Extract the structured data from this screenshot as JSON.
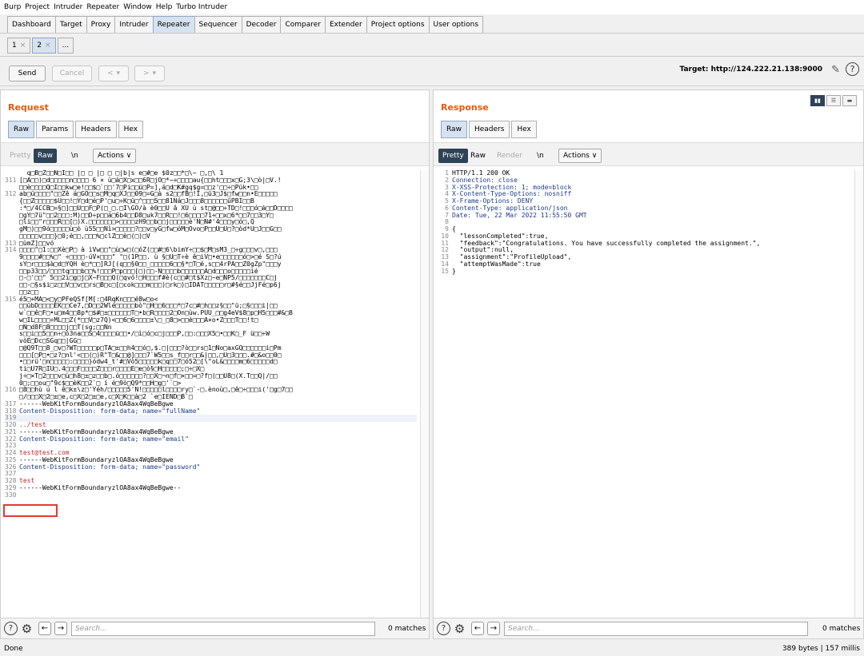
{
  "menu": [
    "Burp",
    "Project",
    "Intruder",
    "Repeater",
    "Window",
    "Help",
    "Turbo Intruder"
  ],
  "main_tabs": [
    "Dashboard",
    "Target",
    "Proxy",
    "Intruder",
    "Repeater",
    "Sequencer",
    "Decoder",
    "Comparer",
    "Extender",
    "Project options",
    "User options"
  ],
  "repeater_tabs": {
    "tab1": "1",
    "tab2": "2",
    "more": "..."
  },
  "toolbar": {
    "send": "Send",
    "cancel": "Cancel",
    "back": "<",
    "back_drop": "▾",
    "fwd": ">",
    "fwd_drop": "▾",
    "target": "Target: http://124.222.21.138:9000"
  },
  "request": {
    "title": "Request",
    "tabs": [
      "Raw",
      "Params",
      "Headers",
      "Hex"
    ],
    "pretty": "Pretty",
    "raw": "Raw",
    "newline": "\\n",
    "actions": "Actions ∨",
    "lines": [
      {
        "n": "",
        "t": "  q□B□Z□□N□I□□ |□ □ |□ □ □|b|s e□#□e $0z□□*□\\~ □,□\\ 1"
      },
      {
        "n": "311",
        "t": "[□A□□)□d□□□□□n□□□□ 6 × ù□á□X□x□□6R□jO□*~÷□□□□au{□□ht□□□x□G;3\\□ò|□V.!"
      },
      {
        "n": "",
        "t": "□□è□□□□Q□I□□kw□e!□□$□`□□'7□Pi□□ü□P=],á□d□K#gq$g=□□z'□□÷□Pük•□□"
      },
      {
        "n": "312",
        "t": "ab□ü□□□□\"□□Zê á□GO□□s□M□q□XJ□□09□=G□à s2□□fB□!I,□ü3□J$□fw□□n•E□□□□□"
      },
      {
        "n": "",
        "t": "{□□Z□□□□□$U□□!□Y□d□é□P'□u□÷K□ü□^□□□5□□81Ná□J□□□8□□□□□□ûPBI□□B"
      },
      {
        "n": "",
        "t": ":*□/4CCB□=§□]□□U□□F□P(□_□.□I\\GO/à è0□□U â XU ù st□@□□÷TD□!□□□ó□à□□D□□□□"
      },
      {
        "n": "",
        "t": "□gY□7ü\"□□2□□□:M)□□D÷p□□á□6b4□□D8□uk7□□R□□!□6□□□□71÷□□x□6*□□7□□3□Y□"
      },
      {
        "n": "",
        "t": "□li□□\"r□□□R□□[□)X.□□□□□□□>□□□□zH9□□b□□j□□□□□è'N□N#'4□□□y□ó□,Q"
      },
      {
        "n": "",
        "t": "gM□)□□9ó□□□□□ù□ò ù55□□Nì>□□□□□?□□v□yG□fw□óM□Ovo□P□□U□U□?□òd*U□J□□G□□"
      },
      {
        "n": "",
        "t": "□□□□□v□□□}□0;é□□,□□□%□clZ□□è□(□)□V"
      },
      {
        "n": "313",
        "t": "□ùmZ]□□vó"
      },
      {
        "n": "314",
        "t": "□□□□\"□1:□□Xè□P□ à ìVw□□\"□ù□w□(□óZ(□□#□6\\bimY÷□□$□M□sM3_□÷g□□□v□,□□□"
      },
      {
        "n": "",
        "t": "9□□□□#□□%□\" ÷□□□□-úV×□□□\" \"□(1P□□. ù §□U□T÷è ê□iV□•e□□□□□□ó□>□é S□?ú"
      },
      {
        "n": "",
        "t": "sY□r□□□$à□d□YQH è□*□□]RJ[(q□□§0□□_□□□□□6□□§*□T□é,s□□4rPA□□Z0gZp\"□□□y"
      },
      {
        "n": "",
        "t": "□□p33□□/□□□tq□□□b□□%!□□□P□p□□□[□)□□-N□□□□b□□□□□□A□d□□□o□□□□□ié"
      },
      {
        "n": "",
        "t": "□-□'□□\" 5□□2ì□g□j□X~F□□□Q(□qvó!□H□□□f#è(c□□#□t$Xz□~e□NP5/□□□□□□□C□j"
      },
      {
        "n": "",
        "t": "□□-□§s$i□z□□V□□v□□rs□B□c□[□cok□□□m□□□)□rk□)□IDAT□□□□□r□#§é□□JjFé□p6j"
      },
      {
        "n": "",
        "t": "□□z□□"
      },
      {
        "n": "315",
        "t": "é5□+MA□<□y□PFeQSf[M[:□4RqKn□□□é8w□o<"
      },
      {
        "n": "",
        "t": "□□übD□□□□EK□□Ce7,□D□□2Wlé□□□□□bò\"□H□□6□□□*□7c□#□h□□z§□□\"ü;□§□□□i|□□"
      },
      {
        "n": "",
        "t": "w`□□ê□F□•u□m4□□8p*□$#□±□□□□□□T□•b□R□□□□2□On□ùw.PUU_□□g4eV$8□p□H5□□□#&□8"
      },
      {
        "n": "",
        "t": "w□IL□□□□÷ML□□Z(*□□V□z7Q)<□□6□6□□□□±\\□_□8□>□□è□□□A×o•Z□□□T□□!t□"
      },
      {
        "n": "",
        "t": "□N□d8F□8□□□□j□□T(sg;□□Nn"
      },
      {
        "n": "",
        "t": "s□□i□□5□□n÷□ò3na□□S□4□□□□ü□□•/□ì□ó□c□j□□□P,□□:□□□X5□•□□K□_F ü□□÷W"
      },
      {
        "n": "",
        "t": "vòÉ□Dc□SGq□□|GG□"
      },
      {
        "n": "",
        "t": "□@Q9T□□8_□v□?WT□□□□□p□TA□±□□h4□□ó□,$.□|□□□?ò□□rs□1□No□axGQ□□□□□□i□Pm"
      },
      {
        "n": "",
        "t": "□□□[□P□•□z?□nl'<□□(□)R\"T□&□□@]□□□7`W5□□s_f□□r□□&|□□,□U□3□□□.#□&o□□0□"
      },
      {
        "n": "",
        "t": "•□□rü'□n□□□□□:□□□□}ódw4_t'#□Vò5□□□□□k□q□□7□ó52□[\\\"oL&□□□□m□6□□□□□d□"
      },
      {
        "n": "",
        "t": "ti□U7R□IU□.4□□□F□□□□Z□□□r□□□□E□e□ò§□H□□□□□;□÷□X□"
      },
      {
        "n": "",
        "t": "j÷□×T□2□□□v□ù□h8□±□z□□b□.ó□□□□□□?□□X□¬n□f□×□□=□?f□(□□U8□(X.T□□Q|/□□"
      },
      {
        "n": "",
        "t": "0□;□□ou□\"9c$□□èK□□2`□ í é□9ò□Q9*□□H□g□'`□>"
      },
      {
        "n": "316",
        "t": "□8□□hù ú l ê□k±\\z□'Yéh/□□□□□5'N!□□□□□l□□□□ry□`-□.ènoù□,□ê□÷□□□i('□g□7□□"
      },
      {
        "n": "",
        "t": "□/□□□X□2□±□e,c□X□2□±□e,c□X□K□□à□2 `e□IEND□B`□"
      },
      {
        "n": "317",
        "t": "------WebKitFormBoundaryzlOA8ax4WqBeBgwe"
      },
      {
        "n": "318",
        "t": "Content-Disposition: form-data; name=\"fullName\""
      },
      {
        "n": "319",
        "t": ""
      },
      {
        "n": "320",
        "t": "../test"
      },
      {
        "n": "321",
        "t": "------WebKitFormBoundaryzlOA8ax4WqBeBgwe"
      },
      {
        "n": "322",
        "t": "Content-Disposition: form-data; name=\"email\""
      },
      {
        "n": "323",
        "t": ""
      },
      {
        "n": "324",
        "t": "test@test.com"
      },
      {
        "n": "325",
        "t": "------WebKitFormBoundaryzlOA8ax4WqBeBgwe"
      },
      {
        "n": "326",
        "t": "Content-Disposition: form-data; name=\"password\""
      },
      {
        "n": "327",
        "t": ""
      },
      {
        "n": "328",
        "t": "test"
      },
      {
        "n": "329",
        "t": "------WebKitFormBoundaryzlOA8ax4WqBeBgwe--"
      },
      {
        "n": "330",
        "t": ""
      }
    ],
    "search_placeholder": "Search...",
    "matches": "0 matches"
  },
  "response": {
    "title": "Response",
    "tabs": [
      "Raw",
      "Headers",
      "Hex"
    ],
    "pretty": "Pretty",
    "raw": "Raw",
    "render": "Render",
    "newline": "\\n",
    "actions": "Actions ∨",
    "lines": [
      {
        "n": "1",
        "t": "HTTP/1.1 200 OK"
      },
      {
        "n": "2",
        "t": "Connection: close"
      },
      {
        "n": "3",
        "t": "X-XSS-Protection: 1; mode=block"
      },
      {
        "n": "4",
        "t": "X-Content-Type-Options: nosniff"
      },
      {
        "n": "5",
        "t": "X-Frame-Options: DENY"
      },
      {
        "n": "6",
        "t": "Content-Type: application/json"
      },
      {
        "n": "7",
        "t": "Date: Tue, 22 Mar 2022 11:55:50 GMT"
      },
      {
        "n": "8",
        "t": ""
      },
      {
        "n": "9",
        "t": "{"
      },
      {
        "n": "10",
        "t": "  \"lessonCompleted\":true,"
      },
      {
        "n": "11",
        "t": "  \"feedback\":\"Congratulations. You have successfully completed the assignment.\","
      },
      {
        "n": "12",
        "t": "  \"output\":null,"
      },
      {
        "n": "13",
        "t": "  \"assignment\":\"ProfileUpload\","
      },
      {
        "n": "14",
        "t": "  \"attemptWasMade\":true"
      },
      {
        "n": "15",
        "t": "}"
      }
    ],
    "search_placeholder": "Search...",
    "matches": "0 matches"
  },
  "status": {
    "left": "Done",
    "right": "389 bytes | 157 millis"
  },
  "colors": {
    "accent": "#e8590c",
    "active_tab": "#d6e2f0",
    "dark_button": "#2d4357",
    "highlight": "#e53935"
  }
}
